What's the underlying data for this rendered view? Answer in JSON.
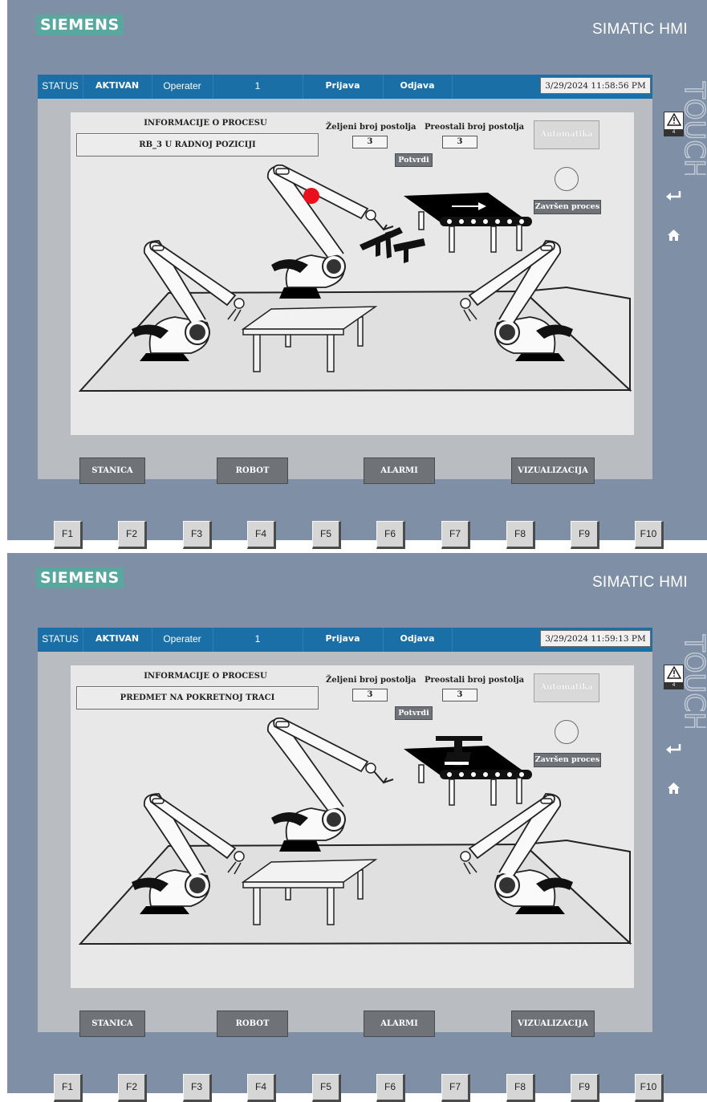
{
  "brand": {
    "logo": "SIEMENS",
    "product": "SIMATIC HMI",
    "side_label": "TOUCH"
  },
  "panels": [
    {
      "statusbar": {
        "status": "STATUS",
        "state": "AKTIVAN",
        "user": "Operater",
        "user_value": "1",
        "login": "Prijava",
        "logout": "Odjava",
        "datetime": "3/29/2024 11:58:56 PM"
      },
      "process": {
        "title": "INFORMACIJE O PROCESU",
        "message": "RB_3 U RADNOJ POZICIJI"
      },
      "desired": {
        "label": "Željeni broj postolja",
        "value": "3"
      },
      "remaining": {
        "label": "Preostali broj postolja",
        "value": "3"
      },
      "confirm_label": "Potvrdi",
      "auto_label": "Automatika",
      "done_label": "Završen proces",
      "indicator_red": true,
      "part_on_conveyor": false
    },
    {
      "statusbar": {
        "status": "STATUS",
        "state": "AKTIVAN",
        "user": "Operater",
        "user_value": "1",
        "login": "Prijava",
        "logout": "Odjava",
        "datetime": "3/29/2024 11:59:13 PM"
      },
      "process": {
        "title": "INFORMACIJE O PROCESU",
        "message": "PREDMET NA POKRETNOJ TRACI"
      },
      "desired": {
        "label": "Željeni broj postolja",
        "value": "3"
      },
      "remaining": {
        "label": "Preostali broj postolja",
        "value": "3"
      },
      "confirm_label": "Potvrdi",
      "auto_label": "Automatika",
      "done_label": "Završen proces",
      "indicator_red": false,
      "part_on_conveyor": true
    }
  ],
  "nav": [
    "STANICA",
    "ROBOT",
    "ALARMI",
    "VIZUALIZACIJA"
  ],
  "alarm_count": "4",
  "icons": {
    "alarm": "warning-icon",
    "back": "return-icon",
    "home": "home-icon"
  },
  "fkeys": [
    "F1",
    "F2",
    "F3",
    "F4",
    "F5",
    "F6",
    "F7",
    "F8",
    "F9",
    "F10"
  ],
  "colors": {
    "frame": "#7e8fa6",
    "header": "#1a6fa7",
    "logo_bg": "#5aa7a0",
    "indicator_active": "#e8101c"
  }
}
